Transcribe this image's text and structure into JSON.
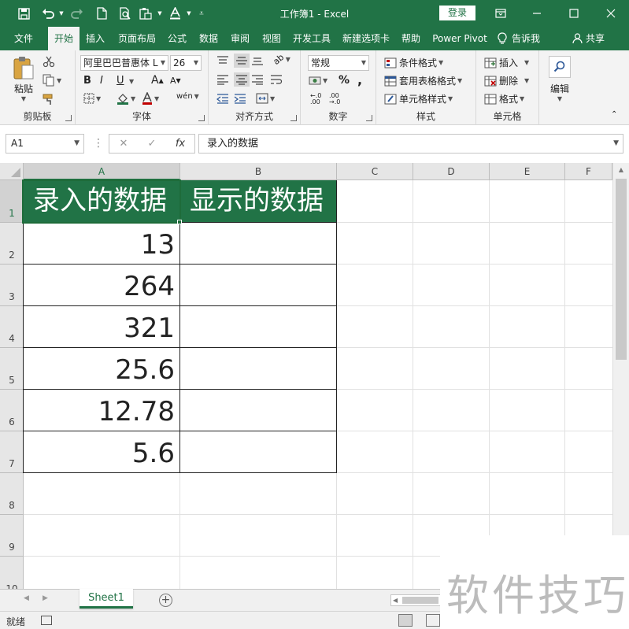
{
  "titlebar": {
    "title": "工作簿1  -  Excel",
    "login_label": "登录",
    "icons": [
      "save-icon",
      "undo-icon",
      "redo-icon",
      "new-document-icon",
      "print-preview-icon",
      "paste-format-icon",
      "font-color-icon",
      "customize-icon"
    ]
  },
  "menu": {
    "tabs": [
      "文件",
      "开始",
      "插入",
      "页面布局",
      "公式",
      "数据",
      "审阅",
      "视图",
      "开发工具",
      "新建选项卡",
      "帮助",
      "Power Pivot"
    ],
    "tell_me": "告诉我",
    "share": "共享"
  },
  "ribbon": {
    "clipboard": {
      "paste": "粘贴",
      "label": "剪贴板"
    },
    "font": {
      "name": "阿里巴巴普惠体 L",
      "size": "26",
      "bold": "B",
      "italic": "I",
      "underline": "U",
      "grow": "A",
      "shrink": "A",
      "label": "字体"
    },
    "alignment": {
      "wrap": "ab",
      "label": "对齐方式"
    },
    "number": {
      "format": "常规",
      "percent": "%",
      "comma": ",",
      "label": "数字"
    },
    "styles": {
      "conditional": "条件格式",
      "table": "套用表格格式",
      "cell": "单元格样式",
      "label": "样式"
    },
    "cells": {
      "insert": "插入",
      "delete": "删除",
      "format": "格式",
      "label": "单元格"
    },
    "editing": {
      "label": "编辑"
    }
  },
  "formula_bar": {
    "name_box": "A1",
    "cancel": "✕",
    "enter": "✓",
    "fx": "fx",
    "content": "录入的数据"
  },
  "grid": {
    "columns": [
      "A",
      "B",
      "C",
      "D",
      "E",
      "F"
    ],
    "rows": [
      "1",
      "2",
      "3",
      "4",
      "5",
      "6",
      "7",
      "8",
      "9",
      "10"
    ],
    "cells": {
      "A1": "录入的数据",
      "B1": "显示的数据",
      "A2": "13",
      "A3": "264",
      "A4": "321",
      "A5": "25.6",
      "A6": "12.78",
      "A7": "5.6"
    },
    "header_fill": "#217346"
  },
  "sheets": {
    "tabs": [
      "Sheet1"
    ],
    "add": "⊕"
  },
  "status": {
    "ready": "就绪"
  },
  "watermark": {
    "text": "软件技巧"
  },
  "colors": {
    "accent": "#217346",
    "ribbon_bg": "#f3f3f3"
  }
}
